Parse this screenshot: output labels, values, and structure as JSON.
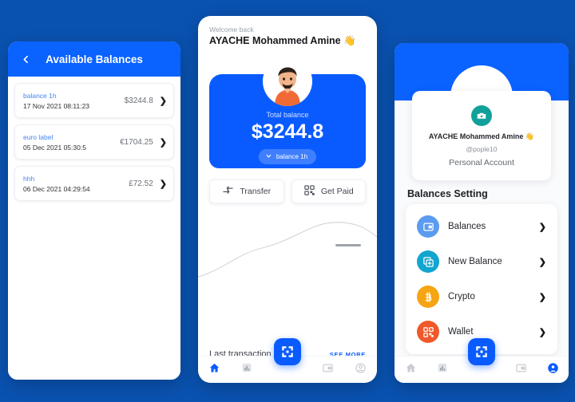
{
  "theme": {
    "background": "#0a52b0",
    "primary_blue": "#0a5bff",
    "header_blue": "#0a62ff",
    "link_blue": "#4285f4",
    "teal": "#12a19a"
  },
  "left_phone": {
    "header": {
      "back_icon": "chevron-left-icon",
      "title": "Available Balances"
    },
    "balances": [
      {
        "label": "balance 1h",
        "date": "17 Nov 2021 08:11:23",
        "amount": "$3244.8"
      },
      {
        "label": "euro label",
        "date": "05 Dec 2021 05:30:5",
        "amount": "€1704.25"
      },
      {
        "label": "hhh",
        "date": "06 Dec 2021 04:29:54",
        "amount": "£72.52"
      }
    ]
  },
  "center_phone": {
    "welcome_small": "Welcome back",
    "welcome_name": "AYACHE Mohammed Amine 👋",
    "avatar_icon": "user-avatar-illustration",
    "total_label": "Total balance",
    "total_amount": "$3244.8",
    "balance_pill": {
      "label": "balance 1h",
      "icon": "chevron-down-icon"
    },
    "actions": [
      {
        "label": "Transfer",
        "icon": "transfer-arrows-icon"
      },
      {
        "label": "Get Paid",
        "icon": "qr-code-icon"
      }
    ],
    "last_transaction_label": "Last transaction",
    "see_more_label": "SEE MORE",
    "fab_icon": "dashboard-grid-icon",
    "nav": [
      {
        "name": "home",
        "icon": "home-icon",
        "active": true
      },
      {
        "name": "stats",
        "icon": "chart-bar-icon",
        "active": false
      },
      {
        "name": "wallet",
        "icon": "wallet-icon",
        "active": false
      },
      {
        "name": "profile",
        "icon": "person-icon",
        "active": false
      }
    ]
  },
  "right_phone": {
    "profile": {
      "camera_icon": "camera-icon",
      "name": "AYACHE Mohammed Amine 👋",
      "handle": "@pople10",
      "account_type": "Personal Account"
    },
    "section_title": "Balances Setting",
    "items": [
      {
        "label": "Balances",
        "icon": "wallet-icon",
        "color": "#5b9bf0"
      },
      {
        "label": "New Balance",
        "icon": "add-card-icon",
        "color": "#12a5cf"
      },
      {
        "label": "Crypto",
        "icon": "bitcoin-icon",
        "color": "#f5a413"
      },
      {
        "label": "Wallet",
        "icon": "qr-code-icon",
        "color": "#f0582a"
      }
    ],
    "fab_icon": "dashboard-grid-icon",
    "nav": [
      {
        "name": "home",
        "icon": "home-icon",
        "active": false
      },
      {
        "name": "stats",
        "icon": "chart-bar-icon",
        "active": false
      },
      {
        "name": "wallet",
        "icon": "wallet-icon",
        "active": false
      },
      {
        "name": "profile",
        "icon": "person-icon",
        "active": true
      }
    ]
  }
}
